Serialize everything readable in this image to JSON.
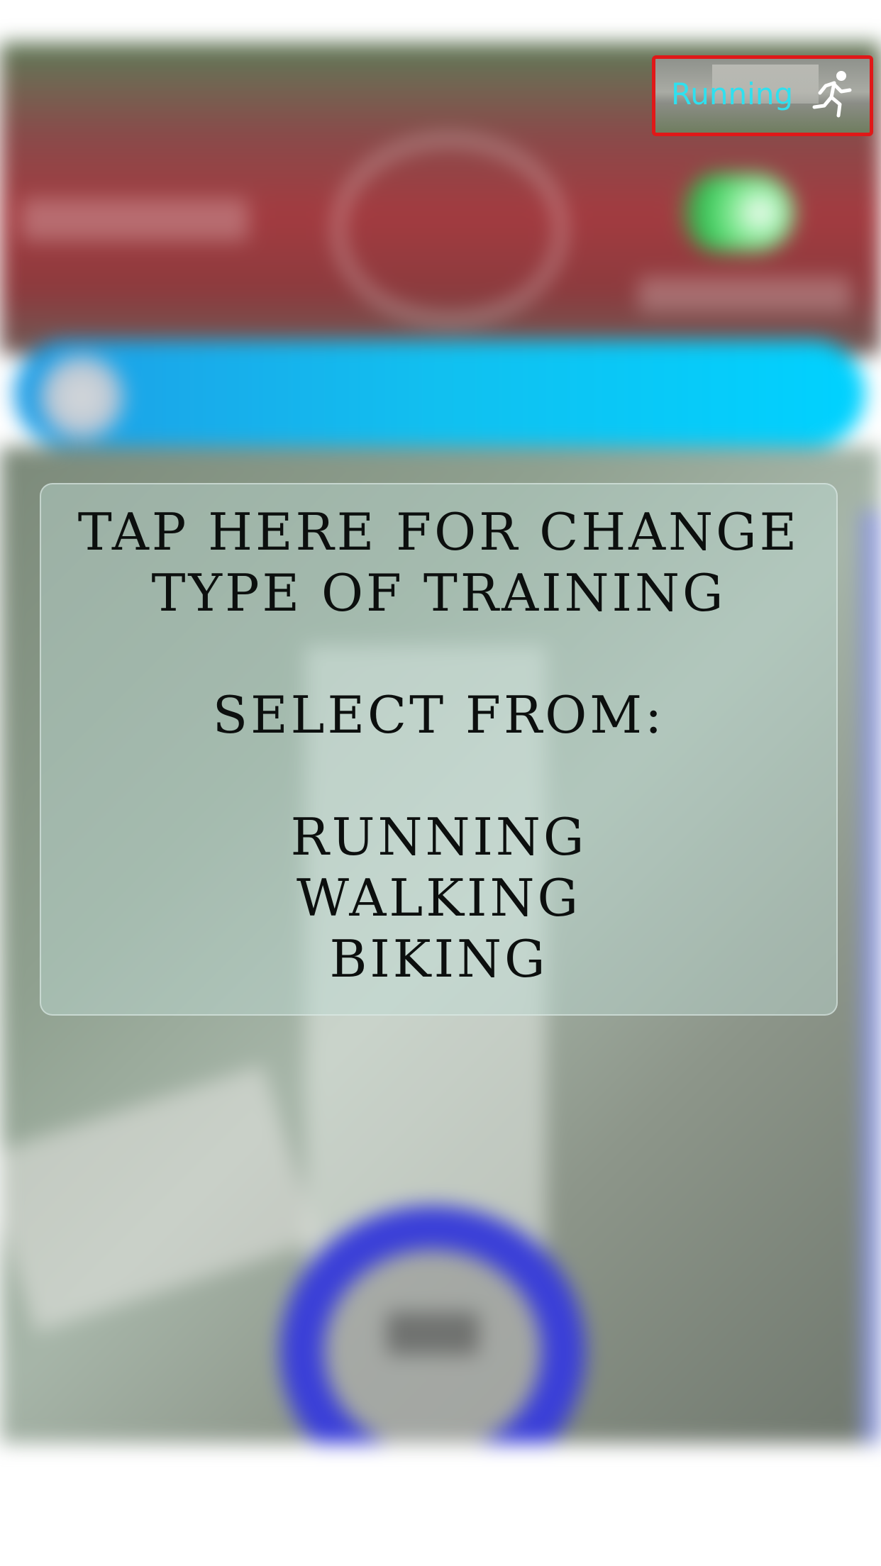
{
  "training_button": {
    "label": "Running",
    "icon": "runner-icon"
  },
  "overlay": {
    "heading_line1": "TAP HERE FOR CHANGE",
    "heading_line2": "TYPE OF TRAINING",
    "select_label": "SELECT FROM:",
    "options": [
      "RUNNING",
      "WALKING",
      "BIKING"
    ]
  },
  "colors": {
    "highlight_border": "#e01818",
    "button_text": "#2fe0ef",
    "progress_bar": "#00d2ff",
    "ring": "#3a3fd8"
  }
}
